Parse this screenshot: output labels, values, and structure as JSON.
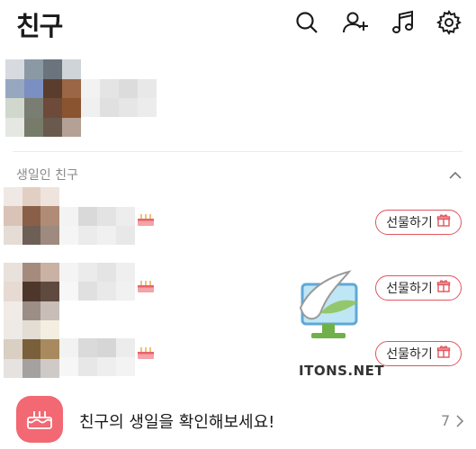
{
  "header": {
    "title": "친구",
    "icons": [
      "search-icon",
      "add-friend-icon",
      "music-icon",
      "settings-icon"
    ]
  },
  "birthday_section": {
    "label": "생일인 친구",
    "gift_button_label": "선물하기",
    "rows": 3
  },
  "watermark": {
    "text": "ITONS.NET"
  },
  "banner": {
    "text": "친구의 생일을 확인해보세요!",
    "count": "7"
  },
  "colors": {
    "accent": "#e0555e",
    "banner_icon_bg": "#f26873"
  }
}
